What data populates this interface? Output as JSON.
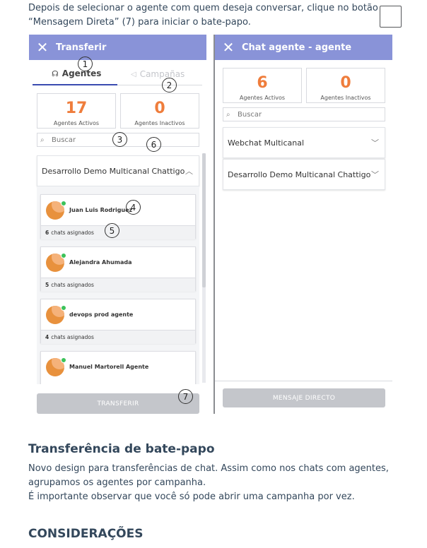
{
  "intro_text": "Depois de selecionar o agente com quem deseja conversar, clique no botão “Mensagem Direta” (7) para iniciar o bate-papo.",
  "left_panel": {
    "title": "Transferir",
    "tabs": [
      {
        "label": "Agentes",
        "icon": "headset-icon",
        "active": true
      },
      {
        "label": "Campañas",
        "icon": "megaphone-icon",
        "active": false
      }
    ],
    "stats": [
      {
        "value": "17",
        "label": "Agentes Activos"
      },
      {
        "value": "0",
        "label": "Agentes Inactivos"
      }
    ],
    "search_placeholder": "Buscar",
    "group": "Desarrollo Demo Multicanal Chattigo",
    "agents": [
      {
        "name": "Juan Luis Rodriguez",
        "count": "6",
        "suffix": "chats asignados"
      },
      {
        "name": "Alejandra Ahumada",
        "count": "5",
        "suffix": "chats asignados"
      },
      {
        "name": "devops prod agente",
        "count": "4",
        "suffix": "chats asignados"
      },
      {
        "name": "Manuel Martorell Agente",
        "count": "",
        "suffix": ""
      }
    ],
    "button": "TRANSFERIR"
  },
  "right_panel": {
    "title": "Chat agente - agente",
    "stats": [
      {
        "value": "6",
        "label": "Agentes Activos"
      },
      {
        "value": "0",
        "label": "Agentes Inactivos"
      }
    ],
    "search_placeholder": "Buscar",
    "groups": [
      "Webchat Multicanal",
      "Desarrollo Demo Multicanal Chattigo"
    ],
    "button": "MENSAJE DIRECTO"
  },
  "callouts": [
    "1",
    "2",
    "3",
    "4",
    "5",
    "6",
    "7"
  ],
  "section_title": "Transferência de bate-papo",
  "section_body": [
    "Novo design para transferências de chat. Assim como nos chats com agentes, agrupamos os agentes por campanha.",
    "É importante observar que você só pode abrir uma campanha por vez."
  ],
  "considerations_title": "CONSIDERAÇÕES",
  "colors": {
    "header": "#8993d8",
    "accent": "#ef7d3c",
    "tab_underline": "#3a4bb0",
    "online": "#3cc25a",
    "text": "#33475b"
  }
}
